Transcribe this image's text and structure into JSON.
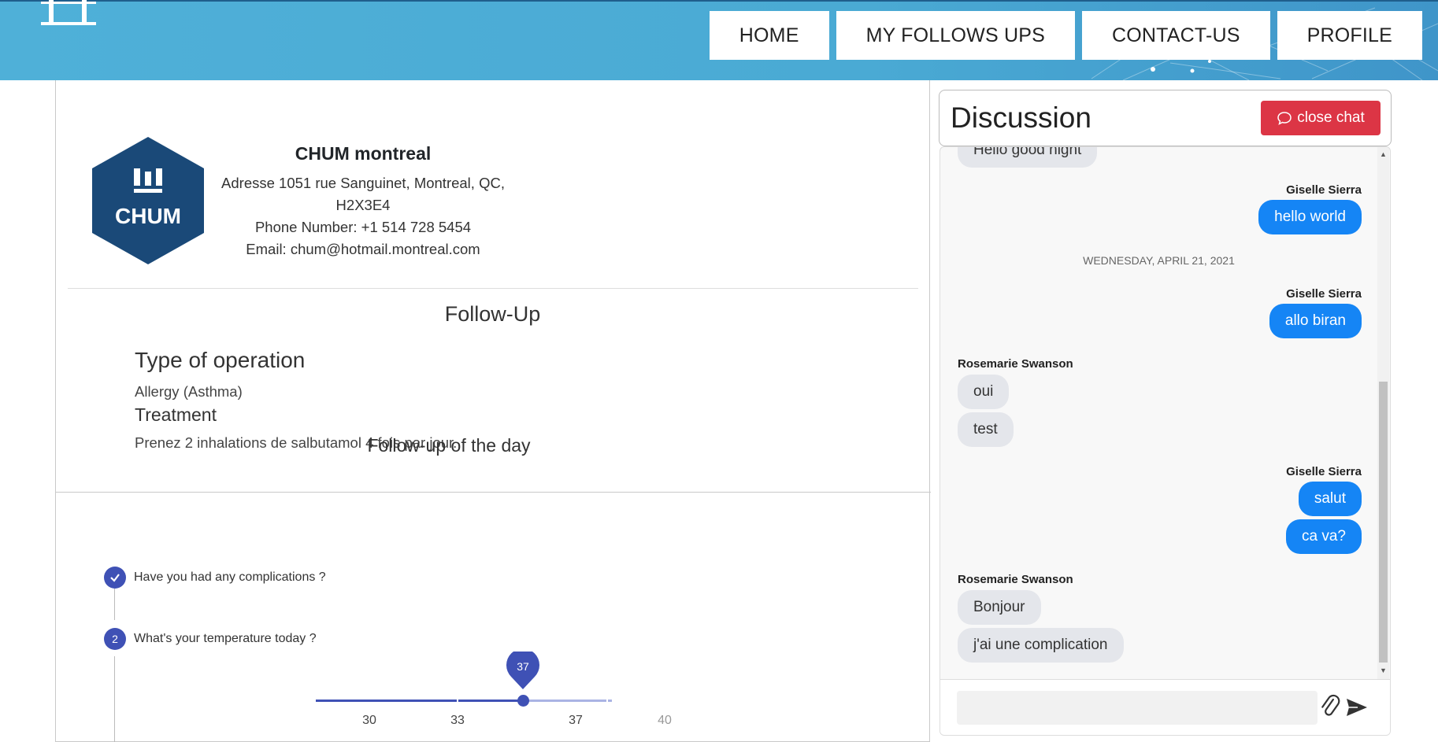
{
  "nav": {
    "items": [
      "HOME",
      "MY FOLLOWS UPS",
      "CONTACT-US",
      "PROFILE"
    ]
  },
  "hospital": {
    "logo_text": "CHUM",
    "name": "CHUM montreal",
    "address": "Adresse 1051 rue Sanguinet, Montreal, QC, H2X3E4",
    "phone": "Phone Number: +1 514 728 5454",
    "email": "Email: chum@hotmail.montreal.com"
  },
  "follow_up": {
    "title": "Follow-Up",
    "operation_label": "Type of operation",
    "operation_value": "Allergy (Asthma)",
    "treatment_label": "Treatment",
    "treatment_value": "Prenez 2 inhalations de salbutamol 4 fois par jour."
  },
  "day": {
    "title": "Follow-up of the day",
    "steps": [
      {
        "number": "✓",
        "label": "Have you had any complications ?"
      },
      {
        "number": "2",
        "label": "What's your temperature today ?"
      }
    ],
    "slider": {
      "value": 37,
      "value_label": "37",
      "min": 30,
      "max": 40,
      "ticks": [
        "30",
        "33",
        "37",
        "40"
      ]
    }
  },
  "chat": {
    "title": "Discussion",
    "close_label": "close chat",
    "partial_message": "Hello good night",
    "date_separator": "WEDNESDAY, APRIL 21, 2021",
    "messages": [
      {
        "sender": "Giselle Sierra",
        "texts": [
          "hello world"
        ]
      },
      {
        "sender": "Giselle Sierra",
        "texts": [
          "allo biran"
        ]
      },
      {
        "sender": "Rosemarie Swanson",
        "texts": [
          "oui",
          "test"
        ]
      },
      {
        "sender": "Giselle Sierra",
        "texts": [
          "salut",
          "ca va?"
        ]
      },
      {
        "sender": "Rosemarie Swanson",
        "texts": [
          "Bonjour",
          "j'ai une complication"
        ]
      }
    ],
    "input_placeholder": ""
  },
  "colors": {
    "header": "#4aaad4",
    "primary": "#3f51b5",
    "danger": "#dc3545",
    "outgoing_bubble": "#1585f5",
    "incoming_bubble": "#e4e6eb",
    "hex_logo": "#1a4978"
  },
  "icons": [
    "logo-icon",
    "chat-bubble-icon",
    "paperclip-icon",
    "send-icon",
    "check-icon"
  ]
}
